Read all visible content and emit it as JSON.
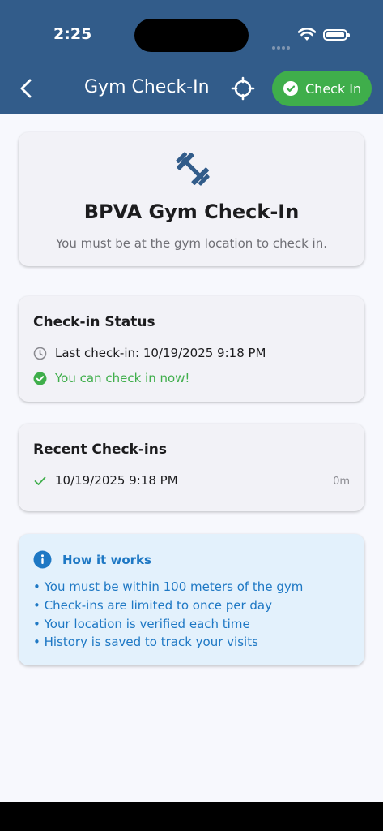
{
  "status_bar": {
    "time": "2:25",
    "icons": [
      "signal-dots-icon",
      "wifi-icon",
      "battery-icon"
    ]
  },
  "nav": {
    "back_icon": "chevron-left-icon",
    "title": "Gym Check-In",
    "locate_icon": "crosshair-icon",
    "checkin_button_label": "Check In",
    "checkin_button_icon": "check-circle-icon"
  },
  "hero": {
    "icon": "dumbbell-icon",
    "title": "BPVA Gym Check-In",
    "subtitle": "You must be at the gym location to check in."
  },
  "checkin_status": {
    "title": "Check-in Status",
    "last_checkin": "Last check-in: 10/19/2025 9:18 PM",
    "status_message": "You can check in now!"
  },
  "recent_checkins": {
    "title": "Recent Check-ins",
    "items": [
      {
        "datetime": "10/19/2025 9:18 PM",
        "duration": "0m"
      }
    ]
  },
  "how_it_works": {
    "title": "How it works",
    "bullets": [
      "• You must be within 100 meters of the gym",
      "• Check-ins are limited to once per day",
      "• Your location is verified each time",
      "• History is saved to track your visits"
    ]
  },
  "colors": {
    "header": "#325c8a",
    "accent_green": "#3fae4b",
    "info_blue": "#1e78c4",
    "info_background": "#e3f1fc",
    "page_background": "#f7f8fd"
  }
}
